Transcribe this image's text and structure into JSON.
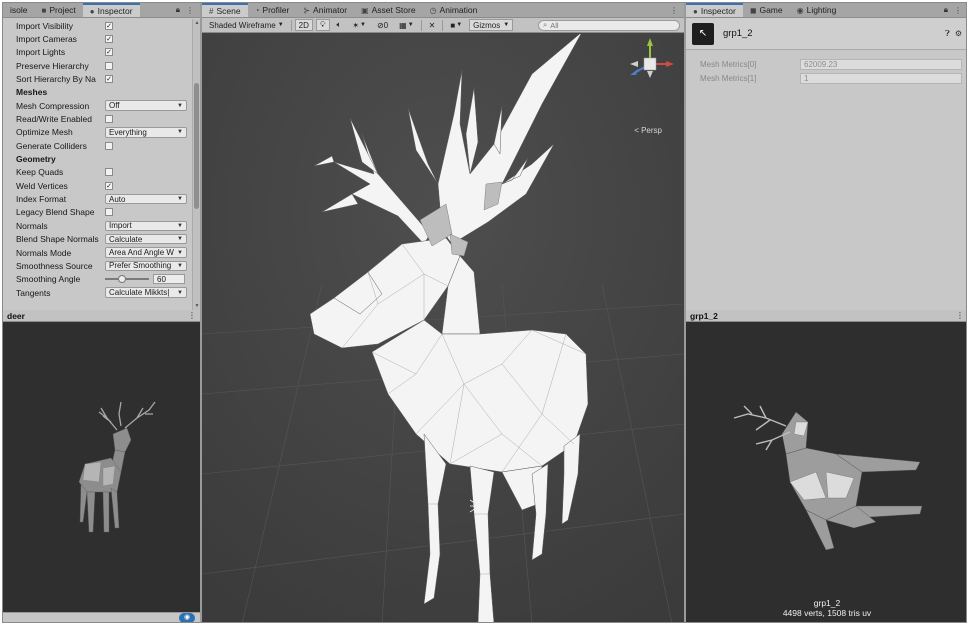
{
  "left_tabs": [
    {
      "label": "isole",
      "icon": ""
    },
    {
      "label": "Project",
      "icon": "folder-icon"
    },
    {
      "label": "Inspector",
      "icon": "info-icon"
    }
  ],
  "left_rows": [
    {
      "label": "Import Visibility",
      "type": "check",
      "checked": "✓"
    },
    {
      "label": "Import Cameras",
      "type": "check",
      "checked": "✓"
    },
    {
      "label": "Import Lights",
      "type": "check",
      "checked": "✓"
    },
    {
      "label": "Preserve Hierarchy",
      "type": "check",
      "checked": ""
    },
    {
      "label": "Sort Hierarchy By Na",
      "type": "check",
      "checked": "✓"
    },
    {
      "label": "Meshes",
      "type": "header"
    },
    {
      "label": "Mesh Compression",
      "type": "dropdown",
      "value": "Off"
    },
    {
      "label": "Read/Write Enabled",
      "type": "check",
      "checked": ""
    },
    {
      "label": "Optimize Mesh",
      "type": "dropdown",
      "value": "Everything"
    },
    {
      "label": "Generate Colliders",
      "type": "check",
      "checked": ""
    },
    {
      "label": "Geometry",
      "type": "header"
    },
    {
      "label": "Keep Quads",
      "type": "check",
      "checked": ""
    },
    {
      "label": "Weld Vertices",
      "type": "check",
      "checked": "✓"
    },
    {
      "label": "Index Format",
      "type": "dropdown",
      "value": "Auto"
    },
    {
      "label": "Legacy Blend Shape",
      "type": "check",
      "checked": ""
    },
    {
      "label": "Normals",
      "type": "dropdown",
      "value": "Import"
    },
    {
      "label": "Blend Shape Normals",
      "type": "dropdown",
      "value": "Calculate"
    },
    {
      "label": "Normals Mode",
      "type": "dropdown",
      "value": "Area And Angle W"
    },
    {
      "label": "Smoothness Source",
      "type": "dropdown",
      "value": "Prefer Smoothing"
    },
    {
      "label": "Smoothing Angle",
      "type": "slider",
      "value": "60"
    },
    {
      "label": "Tangents",
      "type": "dropdown",
      "value": "Calculate Mikkts|"
    }
  ],
  "left_preview": {
    "title": "deer"
  },
  "scene_tabs": [
    {
      "label": "Scene",
      "icon": "grid-icon"
    },
    {
      "label": "Profiler",
      "icon": "profiler-icon"
    },
    {
      "label": "Animator",
      "icon": "animator-icon"
    },
    {
      "label": "Asset Store",
      "icon": "store-icon"
    },
    {
      "label": "Animation",
      "icon": "animation-icon"
    }
  ],
  "scene_toolbar": {
    "shading_mode": "Shaded Wireframe",
    "two_d": "2D",
    "fx_count": "0",
    "gizmos": "Gizmos",
    "search_placeholder": "All"
  },
  "scene_view": {
    "projection": "< Persp"
  },
  "right_tabs": [
    {
      "label": "Inspector",
      "icon": "info-icon"
    },
    {
      "label": "Game",
      "icon": "game-icon"
    },
    {
      "label": "Lighting",
      "icon": "light-icon"
    }
  ],
  "right_inspector": {
    "object_name": "grp1_2",
    "metrics": [
      {
        "label": "Mesh Metrics[0]",
        "value": "62009.23"
      },
      {
        "label": "Mesh Metrics[1]",
        "value": "1"
      }
    ]
  },
  "right_preview": {
    "title": "grp1_2",
    "caption_name": "grp1_2",
    "caption_stats": "4498 verts, 1508 tris  uv"
  }
}
